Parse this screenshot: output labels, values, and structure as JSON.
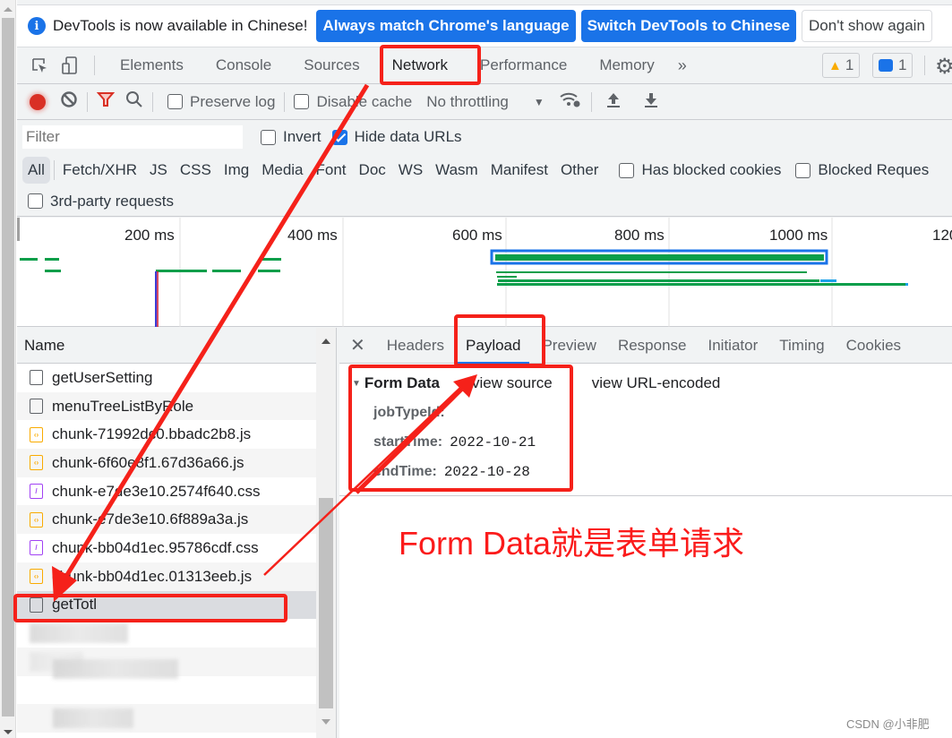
{
  "infobar": {
    "message": "DevTools is now available in Chinese!",
    "buttons": [
      "Always match Chrome's language",
      "Switch DevTools to Chinese",
      "Don't show again"
    ]
  },
  "main_tabs": {
    "items": [
      "Elements",
      "Console",
      "Sources",
      "Network",
      "Performance",
      "Memory"
    ],
    "active": "Network",
    "more_label": "»",
    "warnings_count": "1",
    "messages_count": "1"
  },
  "network_toolbar": {
    "preserve_log": "Preserve log",
    "disable_cache": "Disable cache",
    "throttling": "No throttling",
    "preserve_log_checked": false,
    "disable_cache_checked": false
  },
  "filter": {
    "placeholder": "Filter",
    "invert": "Invert",
    "hide_data_urls": "Hide data URLs",
    "hide_data_urls_checked": true,
    "types": [
      "All",
      "Fetch/XHR",
      "JS",
      "CSS",
      "Img",
      "Media",
      "Font",
      "Doc",
      "WS",
      "Wasm",
      "Manifest",
      "Other"
    ],
    "active_type": "All",
    "has_blocked_cookies": "Has blocked cookies",
    "blocked_requests": "Blocked Reques",
    "third_party": "3rd-party requests"
  },
  "overview": {
    "ticks": [
      "200 ms",
      "400 ms",
      "600 ms",
      "800 ms",
      "1000 ms",
      "120"
    ]
  },
  "request_list": {
    "header": "Name",
    "rows": [
      {
        "name": "getUserSetting",
        "type": "xhr"
      },
      {
        "name": "menuTreeListByRole",
        "type": "xhr"
      },
      {
        "name": "chunk-71992dc0.bbadc2b8.js",
        "type": "js"
      },
      {
        "name": "chunk-6f60e8f1.67d36a66.js",
        "type": "js"
      },
      {
        "name": "chunk-e7de3e10.2574f640.css",
        "type": "css"
      },
      {
        "name": "chunk-e7de3e10.6f889a3a.js",
        "type": "js"
      },
      {
        "name": "chunk-bb04d1ec.95786cdf.css",
        "type": "css"
      },
      {
        "name": "chunk-bb04d1ec.01313eeb.js",
        "type": "js"
      },
      {
        "name": "getTotl",
        "type": "xhr",
        "selected": true
      }
    ]
  },
  "detail": {
    "tabs": [
      "Headers",
      "Payload",
      "Preview",
      "Response",
      "Initiator",
      "Timing",
      "Cookies"
    ],
    "active_tab": "Payload",
    "form_data": {
      "title": "Form Data",
      "view_source": "view source",
      "view_url_encoded": "view URL-encoded",
      "fields": [
        {
          "key": "jobTypeId:",
          "value": ""
        },
        {
          "key": "startTime:",
          "value": "2022-10-21"
        },
        {
          "key": "endTime:",
          "value": "2022-10-28"
        }
      ]
    }
  },
  "annotation": {
    "text": "Form Data就是表单请求",
    "color": "#fb1b1b"
  },
  "watermark": "CSDN @小非肥",
  "colors": {
    "accent": "#1a73e8",
    "record": "#d93025",
    "annotation_red": "#f5211a",
    "waterfall_green": "#0a9e4a"
  }
}
